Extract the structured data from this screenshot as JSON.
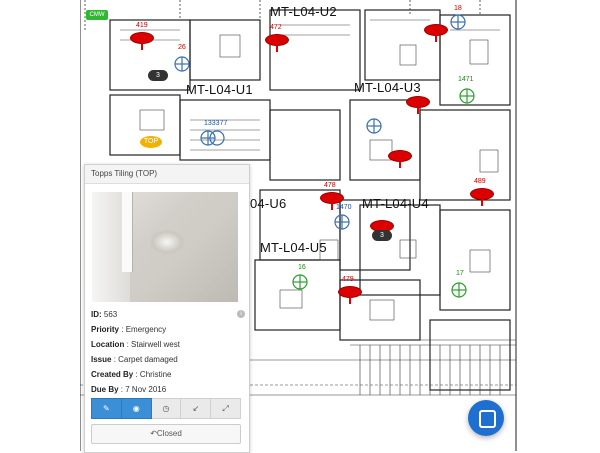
{
  "floorplan": {
    "units": [
      "MT-L04-U2",
      "MT-L04-U1",
      "MT-L04-U3",
      "04-U6",
      "MT-L04-U4",
      "MT-L04-U5"
    ],
    "pins": [
      "419",
      "472",
      "18",
      "26",
      "1471",
      "133377",
      "489",
      "478",
      "1470",
      "17",
      "479",
      "16",
      "3",
      "3"
    ],
    "tags": {
      "green": "CMW",
      "yellow": "TOP"
    }
  },
  "panel": {
    "title": "Topps Tiling (TOP)",
    "id_label": "ID:",
    "id_value": "563",
    "priority_label": "Priority",
    "priority_value": ": Emergency",
    "location_label": "Location",
    "location_value": ": Stairwell west",
    "issue_label": "Issue",
    "issue_value": ":  Carpet damaged",
    "created_label": "Created By",
    "created_value": ": Christine",
    "due_label": "Due By",
    "due_value": ": 7 Nov 2016",
    "closed_label": "Closed"
  }
}
